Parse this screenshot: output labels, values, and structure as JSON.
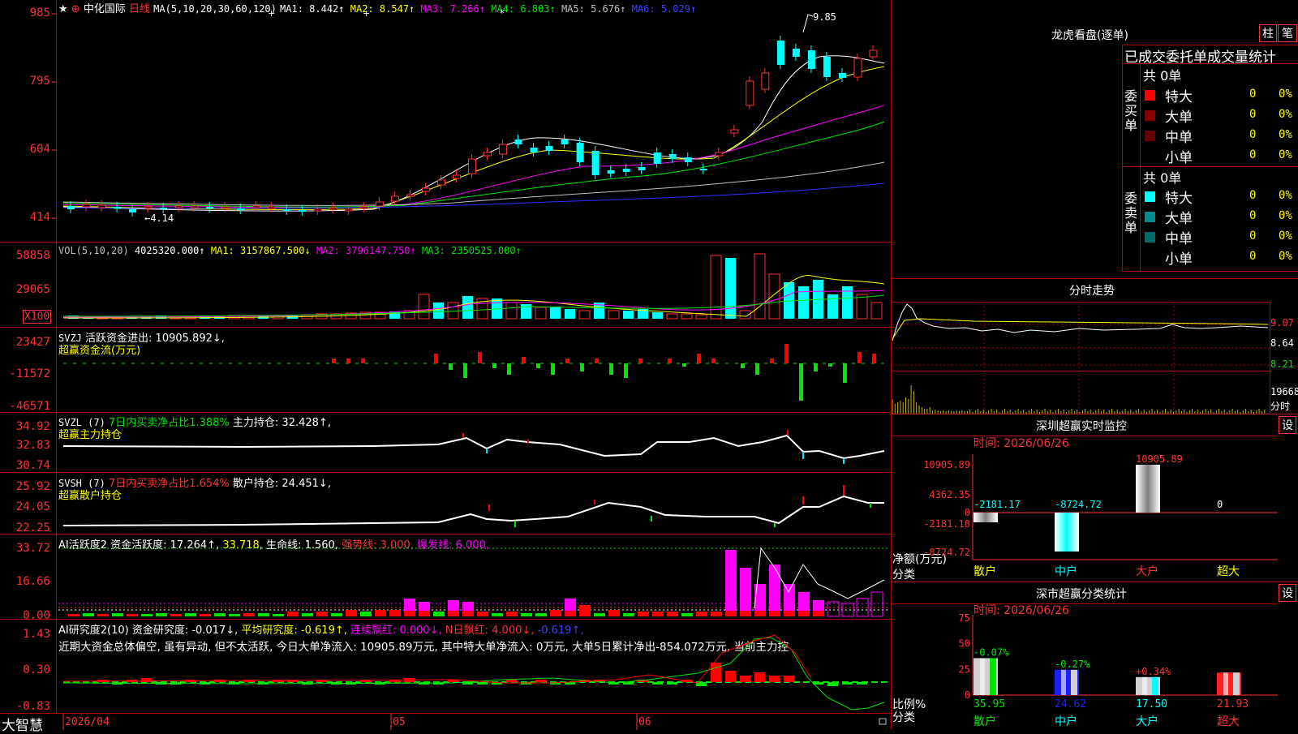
{
  "main_chart": {
    "star": "★",
    "pin": "⊕",
    "stock_name": "中化国际",
    "period": "日线",
    "ma_label": "MA(5,10,20,30,60,120)",
    "ma": [
      {
        "label": "MA1:",
        "value": "8.442↑",
        "color": "#ffffff"
      },
      {
        "label": "MA2:",
        "value": "8.547↑",
        "color": "#ffff00"
      },
      {
        "label": "MA3:",
        "value": "7.266↑",
        "color": "#ff00ff"
      },
      {
        "label": "MA4:",
        "value": "6.803↑",
        "color": "#00e600"
      },
      {
        "label": "MA5:",
        "value": "5.676↑",
        "color": "#c0c0c0"
      },
      {
        "label": "MA6:",
        "value": "5.029↑",
        "color": "#4040ff"
      }
    ],
    "y_ticks": [
      "985",
      "795",
      "604",
      "414"
    ],
    "high_label": "9.85",
    "low_label": "←4.14"
  },
  "volume": {
    "label": "VOL(5,10,20)",
    "value": "4025320.000↑",
    "ma1": "MA1: 3157867.500↓",
    "ma2": "MA2: 3796147.750↑",
    "ma3": "MA3: 2350525.000↑",
    "y_ticks": [
      "58858",
      "29065"
    ],
    "unit": "X100"
  },
  "svzj": {
    "label": "SVZJ",
    "text": "活跃资金进出: 10905.892↓,",
    "sub": "超赢资金流(万元)",
    "y_ticks": [
      "23427",
      "-11572",
      "-46571"
    ]
  },
  "svzl": {
    "label": "SVZL (7)",
    "ratio": "7日内买卖净占比1.388%",
    "hold": "主力持仓: 32.428↑,",
    "sub": "超赢主力持仓",
    "y_ticks": [
      "34.92",
      "32.83",
      "30.74"
    ]
  },
  "svsh": {
    "label": "SVSH (7)",
    "ratio": "7日内买卖净占比1.654%",
    "hold": "散户持仓: 24.451↓,",
    "sub": "超赢散户持仓",
    "y_ticks": [
      "25.92",
      "24.05",
      "22.25"
    ]
  },
  "ai_active": {
    "label": "AI活跃度2",
    "a": "资金活跃度: 17.264↑,",
    "b": "33.718,",
    "c": "生命线: 1.560,",
    "d": "强势线: 3.000,",
    "e": "爆发线: 6.000,",
    "y_ticks": [
      "33.72",
      "16.66",
      "0.00"
    ]
  },
  "ai_research": {
    "label": "AI研究度2(10)",
    "a": "资金研究度: -0.017↓,",
    "b": "平均研究度: -0.619↑,",
    "c": "连续飘红: 0.000↓,",
    "d": "N日飘红: 4.000↓,",
    "e": "-0.619↑,",
    "comment": "近期大资金总体偏空, 虽有异动, 但不太活跃, 今日大单净流入: 10905.89万元, 其中特大单净流入: 0万元, 大单5日累计净出-854.072万元, 当前主力控",
    "y_ticks": [
      "1.43",
      "0.30",
      "-0.83"
    ]
  },
  "bottom_bar": {
    "brand": "大智慧",
    "date": "2026/04",
    "m5": "05",
    "m6": "06"
  },
  "lhb": {
    "title": "龙虎看盘(逐单)",
    "btn1": "柱",
    "btn2": "笔",
    "subtitle": "已成交委托单成交量统计",
    "buy_label": "委买单",
    "sell_label": "委卖单",
    "buy_total": "共 0单",
    "sell_total": "共 0单",
    "buy_rows": [
      {
        "name": "特大",
        "count": "0",
        "pct": "0%",
        "color": "#ff0000"
      },
      {
        "name": "大单",
        "count": "0",
        "pct": "0%",
        "color": "#8c0000"
      },
      {
        "name": "中单",
        "count": "0",
        "pct": "0%",
        "color": "#6a0000"
      },
      {
        "name": "小单",
        "count": "0",
        "pct": "0%",
        "color": ""
      }
    ],
    "sell_rows": [
      {
        "name": "特大",
        "count": "0",
        "pct": "0%",
        "color": "#00ffff"
      },
      {
        "name": "大单",
        "count": "0",
        "pct": "0%",
        "color": "#008c8c"
      },
      {
        "name": "中单",
        "count": "0",
        "pct": "0%",
        "color": "#006a6a"
      },
      {
        "name": "小单",
        "count": "0",
        "pct": "0%",
        "color": ""
      }
    ]
  },
  "intraday": {
    "title": "分时走势",
    "y_ticks": [
      "9.07",
      "8.64",
      "8.21"
    ],
    "vol_label": "19668",
    "unit": "分时"
  },
  "sz_monitor": {
    "title": "深圳超赢实时监控",
    "settings": "设",
    "time": "时间: 2026/06/26",
    "y_ticks": [
      "10905.89",
      "4362.35",
      "0",
      "-2181.18",
      "-8724.72"
    ],
    "net_label": "净额(万元)",
    "cat_label": "分类",
    "bars": [
      {
        "name": "散户",
        "value": -2181.17,
        "label": "-2181.17"
      },
      {
        "name": "中户",
        "value": -8724.72,
        "label": "-8724.72"
      },
      {
        "name": "大户",
        "value": 10905.89,
        "label": "10905.89"
      },
      {
        "name": "超大",
        "value": 0,
        "label": "0"
      }
    ]
  },
  "sz_class": {
    "title": "深市超赢分类统计",
    "settings": "设",
    "time": "时间: 2026/06/26",
    "y_ticks": [
      "75",
      "50",
      "25",
      "0"
    ],
    "ratio_label": "比例%",
    "cat_label": "分类",
    "bars": [
      {
        "name": "散户",
        "value": 35.95,
        "label": "35.95",
        "change": "-0.07%"
      },
      {
        "name": "中户",
        "value": 24.62,
        "label": "24.62",
        "change": "-0.27%"
      },
      {
        "name": "大户",
        "value": 17.5,
        "label": "17.50",
        "change": "+0.34%"
      },
      {
        "name": "超大",
        "value": 21.93,
        "label": "21.93",
        "change": ""
      }
    ]
  }
}
